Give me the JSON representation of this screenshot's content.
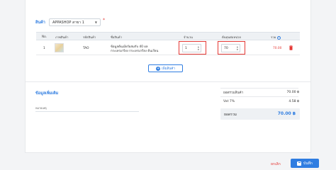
{
  "product_section": {
    "label": "สินค้า",
    "branch_select_value": "APPASHOP สาขา 1",
    "required_mark": "*"
  },
  "table": {
    "headers": [
      "No.",
      "ภาพสินค้า",
      "รหัสสินค้า",
      "ชื่อสินค้า",
      "จำนวน",
      "ต้นทุนต่อหน่วย",
      "รวม"
    ],
    "info_icon": "i",
    "rows": [
      {
        "no": "1",
        "sku": "TAO",
        "name_line1": "ข้อมูลต้นเมียร์ผสมกับ 40 ผล",
        "name_line2": "กระเทรเกรียง กระเทรเกรียง ต้นเรียน",
        "qty": "1",
        "unit_cost": "70",
        "total": "70.00"
      }
    ],
    "add_button_label": "เพิ่มสินค้า"
  },
  "additional": {
    "title": "ข้อมูลเพิ่มเติม",
    "note_label": "หมายเหตุ",
    "note_value": ""
  },
  "summary": {
    "subtotal_label": "ยอดรวมสินค้า",
    "subtotal_value": "70.00 ฿",
    "vat_label": "Vat 7%",
    "vat_value": "4.58 ฿",
    "total_label": "ยอดรวม",
    "total_value": "70.00 ฿"
  },
  "footer": {
    "cancel_label": "ยกเลิก",
    "save_label": "บันทึก"
  },
  "colors": {
    "accent": "#2f7de1",
    "danger": "#e53935",
    "highlight_border": "#e53935"
  },
  "icons": [
    "chevron-down-icon",
    "plus-circle-icon",
    "trash-icon",
    "info-icon",
    "save-icon",
    "stepper-icon"
  ]
}
